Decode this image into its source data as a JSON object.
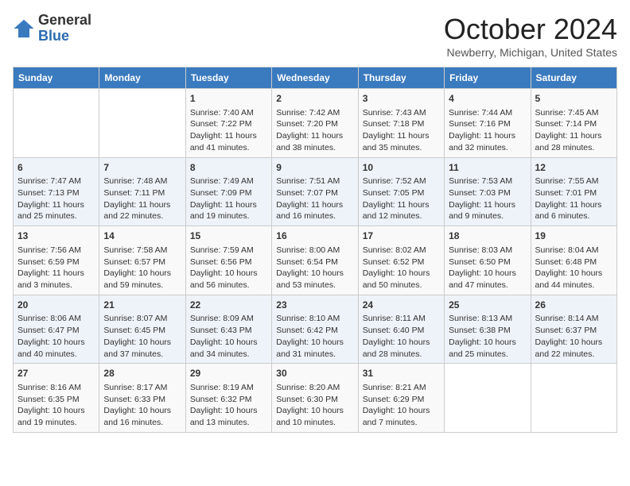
{
  "header": {
    "logo_general": "General",
    "logo_blue": "Blue",
    "month": "October 2024",
    "location": "Newberry, Michigan, United States"
  },
  "days_of_week": [
    "Sunday",
    "Monday",
    "Tuesday",
    "Wednesday",
    "Thursday",
    "Friday",
    "Saturday"
  ],
  "weeks": [
    [
      {
        "day": "",
        "sunrise": "",
        "sunset": "",
        "daylight": ""
      },
      {
        "day": "",
        "sunrise": "",
        "sunset": "",
        "daylight": ""
      },
      {
        "day": "1",
        "sunrise": "Sunrise: 7:40 AM",
        "sunset": "Sunset: 7:22 PM",
        "daylight": "Daylight: 11 hours and 41 minutes."
      },
      {
        "day": "2",
        "sunrise": "Sunrise: 7:42 AM",
        "sunset": "Sunset: 7:20 PM",
        "daylight": "Daylight: 11 hours and 38 minutes."
      },
      {
        "day": "3",
        "sunrise": "Sunrise: 7:43 AM",
        "sunset": "Sunset: 7:18 PM",
        "daylight": "Daylight: 11 hours and 35 minutes."
      },
      {
        "day": "4",
        "sunrise": "Sunrise: 7:44 AM",
        "sunset": "Sunset: 7:16 PM",
        "daylight": "Daylight: 11 hours and 32 minutes."
      },
      {
        "day": "5",
        "sunrise": "Sunrise: 7:45 AM",
        "sunset": "Sunset: 7:14 PM",
        "daylight": "Daylight: 11 hours and 28 minutes."
      }
    ],
    [
      {
        "day": "6",
        "sunrise": "Sunrise: 7:47 AM",
        "sunset": "Sunset: 7:13 PM",
        "daylight": "Daylight: 11 hours and 25 minutes."
      },
      {
        "day": "7",
        "sunrise": "Sunrise: 7:48 AM",
        "sunset": "Sunset: 7:11 PM",
        "daylight": "Daylight: 11 hours and 22 minutes."
      },
      {
        "day": "8",
        "sunrise": "Sunrise: 7:49 AM",
        "sunset": "Sunset: 7:09 PM",
        "daylight": "Daylight: 11 hours and 19 minutes."
      },
      {
        "day": "9",
        "sunrise": "Sunrise: 7:51 AM",
        "sunset": "Sunset: 7:07 PM",
        "daylight": "Daylight: 11 hours and 16 minutes."
      },
      {
        "day": "10",
        "sunrise": "Sunrise: 7:52 AM",
        "sunset": "Sunset: 7:05 PM",
        "daylight": "Daylight: 11 hours and 12 minutes."
      },
      {
        "day": "11",
        "sunrise": "Sunrise: 7:53 AM",
        "sunset": "Sunset: 7:03 PM",
        "daylight": "Daylight: 11 hours and 9 minutes."
      },
      {
        "day": "12",
        "sunrise": "Sunrise: 7:55 AM",
        "sunset": "Sunset: 7:01 PM",
        "daylight": "Daylight: 11 hours and 6 minutes."
      }
    ],
    [
      {
        "day": "13",
        "sunrise": "Sunrise: 7:56 AM",
        "sunset": "Sunset: 6:59 PM",
        "daylight": "Daylight: 11 hours and 3 minutes."
      },
      {
        "day": "14",
        "sunrise": "Sunrise: 7:58 AM",
        "sunset": "Sunset: 6:57 PM",
        "daylight": "Daylight: 10 hours and 59 minutes."
      },
      {
        "day": "15",
        "sunrise": "Sunrise: 7:59 AM",
        "sunset": "Sunset: 6:56 PM",
        "daylight": "Daylight: 10 hours and 56 minutes."
      },
      {
        "day": "16",
        "sunrise": "Sunrise: 8:00 AM",
        "sunset": "Sunset: 6:54 PM",
        "daylight": "Daylight: 10 hours and 53 minutes."
      },
      {
        "day": "17",
        "sunrise": "Sunrise: 8:02 AM",
        "sunset": "Sunset: 6:52 PM",
        "daylight": "Daylight: 10 hours and 50 minutes."
      },
      {
        "day": "18",
        "sunrise": "Sunrise: 8:03 AM",
        "sunset": "Sunset: 6:50 PM",
        "daylight": "Daylight: 10 hours and 47 minutes."
      },
      {
        "day": "19",
        "sunrise": "Sunrise: 8:04 AM",
        "sunset": "Sunset: 6:48 PM",
        "daylight": "Daylight: 10 hours and 44 minutes."
      }
    ],
    [
      {
        "day": "20",
        "sunrise": "Sunrise: 8:06 AM",
        "sunset": "Sunset: 6:47 PM",
        "daylight": "Daylight: 10 hours and 40 minutes."
      },
      {
        "day": "21",
        "sunrise": "Sunrise: 8:07 AM",
        "sunset": "Sunset: 6:45 PM",
        "daylight": "Daylight: 10 hours and 37 minutes."
      },
      {
        "day": "22",
        "sunrise": "Sunrise: 8:09 AM",
        "sunset": "Sunset: 6:43 PM",
        "daylight": "Daylight: 10 hours and 34 minutes."
      },
      {
        "day": "23",
        "sunrise": "Sunrise: 8:10 AM",
        "sunset": "Sunset: 6:42 PM",
        "daylight": "Daylight: 10 hours and 31 minutes."
      },
      {
        "day": "24",
        "sunrise": "Sunrise: 8:11 AM",
        "sunset": "Sunset: 6:40 PM",
        "daylight": "Daylight: 10 hours and 28 minutes."
      },
      {
        "day": "25",
        "sunrise": "Sunrise: 8:13 AM",
        "sunset": "Sunset: 6:38 PM",
        "daylight": "Daylight: 10 hours and 25 minutes."
      },
      {
        "day": "26",
        "sunrise": "Sunrise: 8:14 AM",
        "sunset": "Sunset: 6:37 PM",
        "daylight": "Daylight: 10 hours and 22 minutes."
      }
    ],
    [
      {
        "day": "27",
        "sunrise": "Sunrise: 8:16 AM",
        "sunset": "Sunset: 6:35 PM",
        "daylight": "Daylight: 10 hours and 19 minutes."
      },
      {
        "day": "28",
        "sunrise": "Sunrise: 8:17 AM",
        "sunset": "Sunset: 6:33 PM",
        "daylight": "Daylight: 10 hours and 16 minutes."
      },
      {
        "day": "29",
        "sunrise": "Sunrise: 8:19 AM",
        "sunset": "Sunset: 6:32 PM",
        "daylight": "Daylight: 10 hours and 13 minutes."
      },
      {
        "day": "30",
        "sunrise": "Sunrise: 8:20 AM",
        "sunset": "Sunset: 6:30 PM",
        "daylight": "Daylight: 10 hours and 10 minutes."
      },
      {
        "day": "31",
        "sunrise": "Sunrise: 8:21 AM",
        "sunset": "Sunset: 6:29 PM",
        "daylight": "Daylight: 10 hours and 7 minutes."
      },
      {
        "day": "",
        "sunrise": "",
        "sunset": "",
        "daylight": ""
      },
      {
        "day": "",
        "sunrise": "",
        "sunset": "",
        "daylight": ""
      }
    ]
  ]
}
